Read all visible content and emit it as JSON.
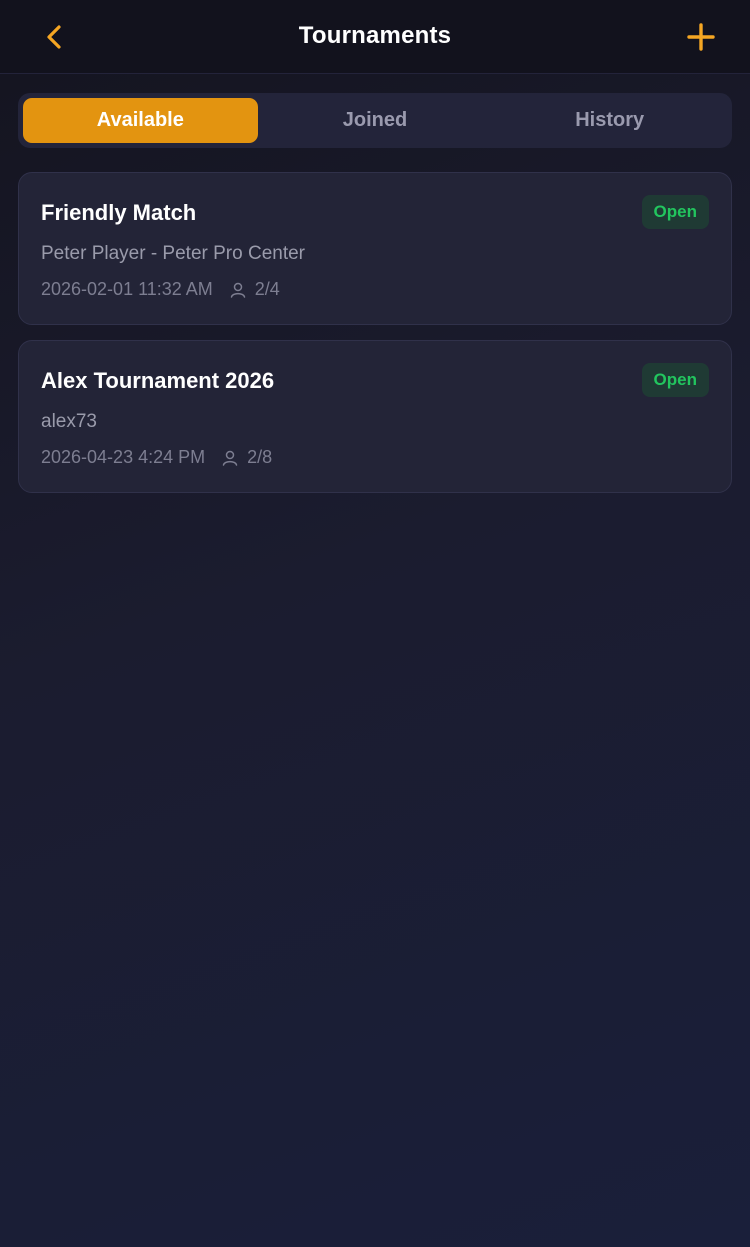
{
  "header": {
    "title": "Tournaments",
    "back_icon": "chevron-left-icon",
    "add_icon": "plus-icon",
    "accent_color": "#f5a623"
  },
  "tabs": [
    {
      "label": "Available",
      "active": true
    },
    {
      "label": "Joined",
      "active": false
    },
    {
      "label": "History",
      "active": false
    }
  ],
  "tournaments": [
    {
      "name": "Friendly Match",
      "status": "Open",
      "subtitle": "Peter Player - Peter Pro Center",
      "datetime": "2026-02-01 11:32 AM",
      "players": "2/4"
    },
    {
      "name": "Alex Tournament 2026",
      "status": "Open",
      "subtitle": "alex73",
      "datetime": "2026-04-23 4:24 PM",
      "players": "2/8"
    }
  ],
  "colors": {
    "tab_active": "#e39410",
    "status_open": "#22c55e"
  }
}
